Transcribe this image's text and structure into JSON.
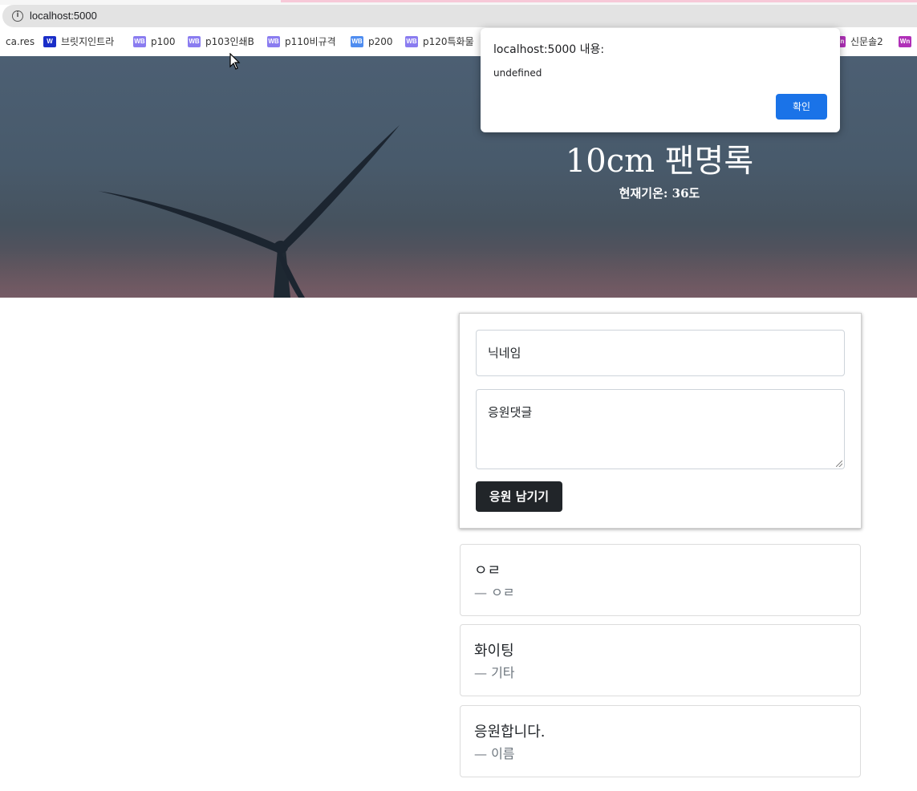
{
  "browser": {
    "url": "localhost:5000",
    "bookmarks": [
      {
        "label": "ca.res",
        "icon": "none"
      },
      {
        "label": "브릿지인트라",
        "icon": "w-icon",
        "icon_text": "W",
        "color": "#1a2ec8"
      },
      {
        "label": "p100",
        "icon": "wb-icon",
        "icon_text": "WB",
        "color": "#8a7cf0"
      },
      {
        "label": "p103인쇄B",
        "icon": "wb-icon",
        "icon_text": "WB",
        "color": "#8a7cf0"
      },
      {
        "label": "p110비규격",
        "icon": "wb-icon",
        "icon_text": "WB",
        "color": "#8a7cf0"
      },
      {
        "label": "p200",
        "icon": "wb-icon",
        "icon_text": "WB",
        "color": "#4f8df0"
      },
      {
        "label": "p120특화물",
        "icon": "wb-icon",
        "icon_text": "WB",
        "color": "#8a7cf0"
      },
      {
        "label": "신문솔2",
        "icon": "wn-icon",
        "icon_text": "Wn",
        "color": "#b030b8"
      },
      {
        "label": "",
        "icon": "wn-icon",
        "icon_text": "Wn",
        "color": "#b030b8"
      }
    ]
  },
  "alert": {
    "title": "localhost:5000 내용:",
    "message": "undefined",
    "ok_label": "확인"
  },
  "hero": {
    "title": "10cm 팬명록",
    "weather_text": "현재기온: 36도"
  },
  "form": {
    "nickname_placeholder": "닉네임",
    "comment_placeholder": "응원댓글",
    "submit_label": "응원 남기기"
  },
  "comments": [
    {
      "text": "ㅇㄹ",
      "author": "— ㅇㄹ"
    },
    {
      "text": "화이팅",
      "author": "— 기타"
    },
    {
      "text": "응원합니다.",
      "author": "— 이름"
    }
  ],
  "colors": {
    "accent": "#1a73e8",
    "button_dark": "#212529",
    "muted_text": "#6c757d"
  }
}
